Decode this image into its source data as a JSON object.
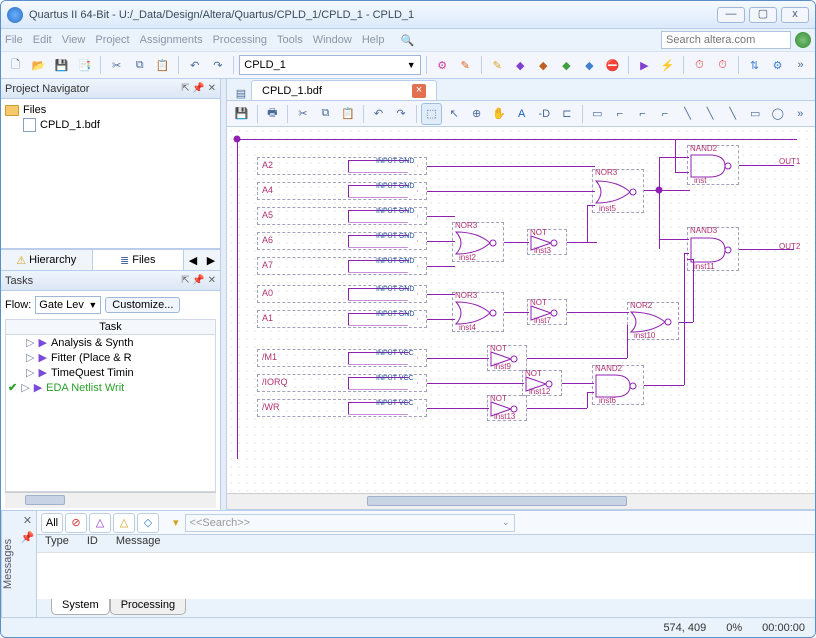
{
  "title": "Quartus II 64-Bit - U:/_Data/Design/Altera/Quartus/CPLD_1/CPLD_1 - CPLD_1",
  "menus": [
    "File",
    "Edit",
    "View",
    "Project",
    "Assignments",
    "Processing",
    "Tools",
    "Window",
    "Help"
  ],
  "search_placeholder": "Search altera.com",
  "project_combo": "CPLD_1",
  "nav": {
    "title": "Project Navigator",
    "root": "Files",
    "file": "CPLD_1.bdf",
    "tabs": {
      "hierarchy": "Hierarchy",
      "files": "Files"
    }
  },
  "tasks": {
    "title": "Tasks",
    "flow_label": "Flow:",
    "flow_value": "Gate Lev",
    "customize": "Customize...",
    "header": "Task",
    "items": [
      "Analysis & Synth",
      "Fitter (Place & R",
      "TimeQuest Timin",
      "EDA Netlist Writ"
    ]
  },
  "doc_tab": "CPLD_1.bdf",
  "pins": [
    "A2",
    "A4",
    "A5",
    "A6",
    "A7",
    "A0",
    "A1",
    "/M1",
    "/IORQ",
    "/WR"
  ],
  "pin_type_addr": "INPUT GND",
  "pin_type_ctrl": "INPUT VCC",
  "gates": {
    "nor3a": {
      "label": "NOR3",
      "inst": "inst2"
    },
    "nor3b": {
      "label": "NOR3",
      "inst": "inst4"
    },
    "nor3c": {
      "label": "NOR3",
      "inst": "inst5"
    },
    "nor2": {
      "label": "NOR2",
      "inst": "inst10"
    },
    "nand2a": {
      "label": "NAND2",
      "inst": "inst"
    },
    "nand2b": {
      "label": "NAND2",
      "inst": "inst6"
    },
    "nand3": {
      "label": "NAND3",
      "inst": "inst11"
    },
    "not1": {
      "label": "NOT",
      "inst": "inst3"
    },
    "not2": {
      "label": "NOT",
      "inst": "inst7"
    },
    "not3": {
      "label": "NOT",
      "inst": "inst9"
    },
    "not4": {
      "label": "NOT",
      "inst": "inst12"
    },
    "not5": {
      "label": "NOT",
      "inst": "inst13"
    }
  },
  "outputs": {
    "o1": "OUT1",
    "o2": "OUT2"
  },
  "messages": {
    "all": "All",
    "search_placeholder": "<<Search>>",
    "cols": [
      "Type",
      "ID",
      "Message"
    ],
    "tabs": [
      "System",
      "Processing"
    ],
    "side": "Messages"
  },
  "status": {
    "coords": "574, 409",
    "pct": "0%",
    "time": "00:00:00"
  }
}
